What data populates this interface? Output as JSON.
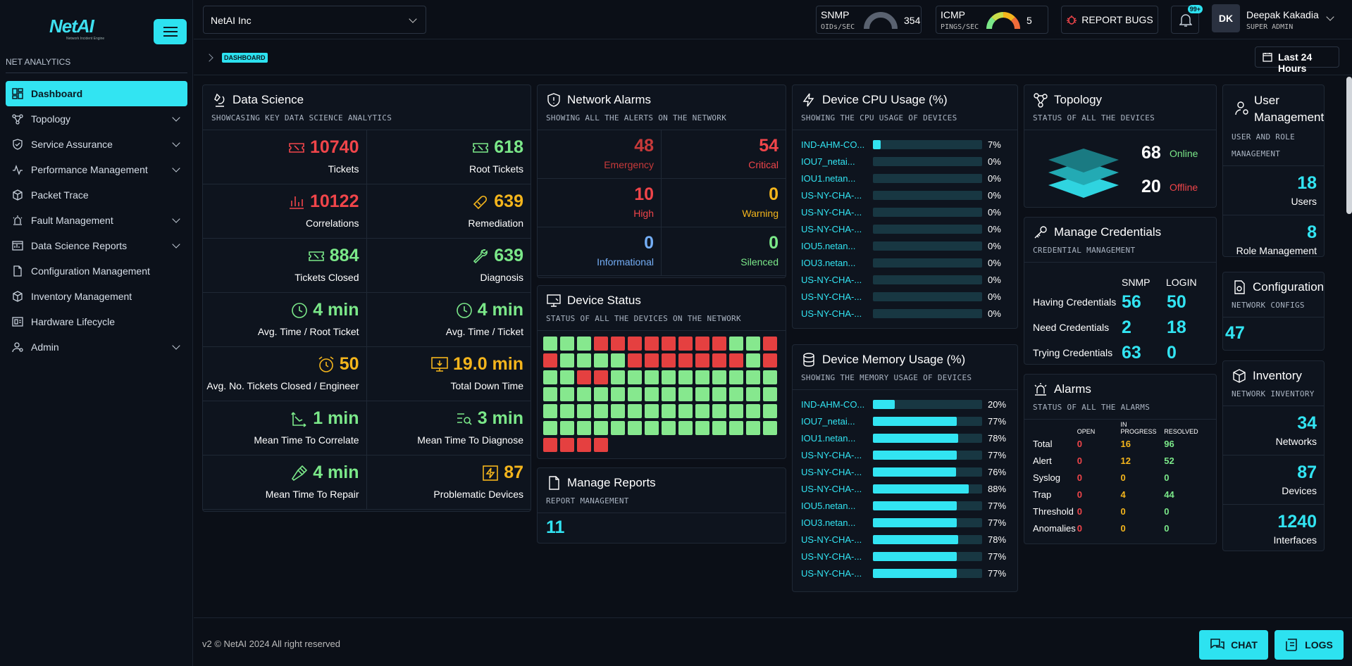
{
  "app": {
    "brand": "NetAI",
    "tagline": "Network Incident Engine"
  },
  "sidebar": {
    "section_title": "NET ANALYTICS",
    "items": [
      {
        "label": "Dashboard",
        "icon": "dashboard-icon",
        "active": true
      },
      {
        "label": "Topology",
        "icon": "topology-icon"
      },
      {
        "label": "Service Assurance",
        "icon": "shield-icon"
      },
      {
        "label": "Performance Management",
        "icon": "pulse-icon"
      },
      {
        "label": "Packet Trace",
        "icon": "package-icon"
      },
      {
        "label": "Fault Management",
        "icon": "siren-icon"
      },
      {
        "label": "Data Science Reports",
        "icon": "report-icon"
      },
      {
        "label": "Configuration Management",
        "icon": "file-icon"
      },
      {
        "label": "Inventory Management",
        "icon": "box-icon"
      },
      {
        "label": "Hardware Lifecycle",
        "icon": "hardware-icon"
      },
      {
        "label": "Admin",
        "icon": "admin-icon"
      }
    ]
  },
  "header": {
    "org": "NetAI Inc",
    "snmp": {
      "label": "SNMP",
      "sub": "OIDs/SEC",
      "value": "354"
    },
    "icmp": {
      "label": "ICMP",
      "sub": "PINGS/SEC",
      "value": "5"
    },
    "report_bugs": "REPORT BUGS",
    "notif_badge": "99+",
    "user": {
      "initials": "DK",
      "name": "Deepak Kakadia",
      "role": "SUPER ADMIN"
    }
  },
  "breadcrumb": {
    "current": "DASHBOARD",
    "range": "Last 24 Hours"
  },
  "data_science": {
    "title": "Data Science",
    "subtitle": "SHOWCASING KEY DATA SCIENCE ANALYTICS",
    "cells": [
      {
        "value": "10740",
        "label": "Tickets",
        "color": "red",
        "icon": "ticket-icon"
      },
      {
        "value": "618",
        "label": "Root Tickets",
        "color": "green",
        "icon": "ticket-icon"
      },
      {
        "value": "10122",
        "label": "Correlations",
        "color": "red",
        "icon": "bar-chart-icon"
      },
      {
        "value": "639",
        "label": "Remediation",
        "color": "amber",
        "icon": "bandage-icon"
      },
      {
        "value": "884",
        "label": "Tickets Closed",
        "color": "green",
        "icon": "ticket-icon"
      },
      {
        "value": "639",
        "label": "Diagnosis",
        "color": "green",
        "icon": "wrench-icon"
      },
      {
        "value": "4 min",
        "label": "Avg. Time / Root Ticket",
        "color": "green",
        "icon": "clock-icon"
      },
      {
        "value": "4 min",
        "label": "Avg. Time / Ticket",
        "color": "green",
        "icon": "clock-icon"
      },
      {
        "value": "50",
        "label": "Avg. No. Tickets Closed / Engineer",
        "color": "amber",
        "icon": "alarm-clock-icon"
      },
      {
        "value": "19.0 min",
        "label": "Total Down Time",
        "color": "amber",
        "icon": "monitor-down-icon"
      },
      {
        "value": "1 min",
        "label": "Mean Time To Correlate",
        "color": "green",
        "icon": "axis-arrow-icon"
      },
      {
        "value": "3 min",
        "label": "Mean Time To Diagnose",
        "color": "green",
        "icon": "list-search-icon"
      },
      {
        "value": "4 min",
        "label": "Mean Time To Repair",
        "color": "green",
        "icon": "hammer-icon"
      },
      {
        "value": "87",
        "label": "Problematic Devices",
        "color": "amber",
        "icon": "bolt-box-icon"
      }
    ]
  },
  "alarms_card": {
    "title": "Network Alarms",
    "subtitle": "SHOWING ALL THE ALERTS ON THE NETWORK",
    "cells": [
      {
        "value": "48",
        "label": "Emergency",
        "color": "dkred"
      },
      {
        "value": "54",
        "label": "Critical",
        "color": "red"
      },
      {
        "value": "10",
        "label": "High",
        "color": "red"
      },
      {
        "value": "0",
        "label": "Warning",
        "color": "amber"
      },
      {
        "value": "0",
        "label": "Informational",
        "color": "blue"
      },
      {
        "value": "0",
        "label": "Silenced",
        "color": "green"
      }
    ]
  },
  "device_status": {
    "title": "Device Status",
    "subtitle": "STATUS OF ALL THE DEVICES ON THE NETWORK",
    "cells": [
      "up",
      "up",
      "up",
      "down",
      "down",
      "down",
      "down",
      "down",
      "down",
      "down",
      "down",
      "up",
      "up",
      "down",
      "down",
      "up",
      "up",
      "up",
      "up",
      "down",
      "down",
      "down",
      "down",
      "down",
      "down",
      "down",
      "up",
      "down",
      "up",
      "up",
      "down",
      "down",
      "up",
      "up",
      "up",
      "up",
      "up",
      "up",
      "up",
      "up",
      "up",
      "up",
      "up",
      "up",
      "up",
      "up",
      "up",
      "up",
      "up",
      "up",
      "up",
      "up",
      "up",
      "up",
      "up",
      "up",
      "up",
      "up",
      "up",
      "up",
      "up",
      "up",
      "up",
      "up",
      "up",
      "up",
      "up",
      "up",
      "up",
      "up",
      "up",
      "up",
      "up",
      "up",
      "up",
      "up",
      "up",
      "up",
      "up",
      "up",
      "up",
      "up",
      "up",
      "up",
      "down",
      "down",
      "down",
      "down"
    ]
  },
  "manage_reports": {
    "title": "Manage Reports",
    "subtitle": "REPORT MANAGEMENT",
    "value": "11"
  },
  "cpu": {
    "title": "Device CPU Usage (%)",
    "subtitle": "SHOWING THE CPU USAGE OF DEVICES",
    "rows": [
      {
        "name": "IND-AHM-CO...",
        "pct": 7,
        "label": "7%"
      },
      {
        "name": "IOU7_netai...",
        "pct": 0,
        "label": "0%"
      },
      {
        "name": "IOU1.netan...",
        "pct": 0,
        "label": "0%"
      },
      {
        "name": "US-NY-CHA-...",
        "pct": 0,
        "label": "0%"
      },
      {
        "name": "US-NY-CHA-...",
        "pct": 0,
        "label": "0%"
      },
      {
        "name": "US-NY-CHA-...",
        "pct": 0,
        "label": "0%"
      },
      {
        "name": "IOU5.netan...",
        "pct": 0,
        "label": "0%"
      },
      {
        "name": "IOU3.netan...",
        "pct": 0,
        "label": "0%"
      },
      {
        "name": "US-NY-CHA-...",
        "pct": 0,
        "label": "0%"
      },
      {
        "name": "US-NY-CHA-...",
        "pct": 0,
        "label": "0%"
      },
      {
        "name": "US-NY-CHA-...",
        "pct": 0,
        "label": "0%"
      }
    ]
  },
  "memory": {
    "title": "Device Memory Usage (%)",
    "subtitle": "SHOWING THE MEMORY USAGE OF DEVICES",
    "rows": [
      {
        "name": "IND-AHM-CO...",
        "pct": 20,
        "label": "20%"
      },
      {
        "name": "IOU7_netai...",
        "pct": 77,
        "label": "77%"
      },
      {
        "name": "IOU1.netan...",
        "pct": 78,
        "label": "78%"
      },
      {
        "name": "US-NY-CHA-...",
        "pct": 77,
        "label": "77%"
      },
      {
        "name": "US-NY-CHA-...",
        "pct": 76,
        "label": "76%"
      },
      {
        "name": "US-NY-CHA-...",
        "pct": 88,
        "label": "88%"
      },
      {
        "name": "IOU5.netan...",
        "pct": 77,
        "label": "77%"
      },
      {
        "name": "IOU3.netan...",
        "pct": 77,
        "label": "77%"
      },
      {
        "name": "US-NY-CHA-...",
        "pct": 78,
        "label": "78%"
      },
      {
        "name": "US-NY-CHA-...",
        "pct": 77,
        "label": "77%"
      },
      {
        "name": "US-NY-CHA-...",
        "pct": 77,
        "label": "77%"
      }
    ]
  },
  "topology": {
    "title": "Topology",
    "subtitle": "STATUS OF ALL THE DEVICES",
    "online_value": "68",
    "online_label": "Online",
    "offline_value": "20",
    "offline_label": "Offline"
  },
  "credentials": {
    "title": "Manage Credentials",
    "subtitle": "CREDENTIAL MANAGEMENT",
    "col1": "SNMP",
    "col2": "LOGIN",
    "rows": [
      {
        "label": "Having Credentials",
        "snmp": "56",
        "login": "50"
      },
      {
        "label": "Need Credentials",
        "snmp": "2",
        "login": "18"
      },
      {
        "label": "Trying Credentials",
        "snmp": "63",
        "login": "0"
      }
    ]
  },
  "alarms_table": {
    "title": "Alarms",
    "subtitle": "STATUS OF ALL THE ALARMS",
    "headers": [
      "OPEN",
      "IN PROGRESS",
      "RESOLVED"
    ],
    "rows": [
      {
        "name": "Total",
        "open": "0",
        "prog": "16",
        "res": "96"
      },
      {
        "name": "Alert",
        "open": "0",
        "prog": "12",
        "res": "52"
      },
      {
        "name": "Syslog",
        "open": "0",
        "prog": "0",
        "res": "0"
      },
      {
        "name": "Trap",
        "open": "0",
        "prog": "4",
        "res": "44"
      },
      {
        "name": "Threshold",
        "open": "0",
        "prog": "0",
        "res": "0"
      },
      {
        "name": "Anomalies",
        "open": "0",
        "prog": "0",
        "res": "0"
      }
    ]
  },
  "user_mgmt": {
    "title": "User Management",
    "subtitle": "USER AND ROLE MANAGEMENT",
    "users_value": "18",
    "users_label": "Users",
    "roles_value": "8",
    "roles_label": "Role Management"
  },
  "configurations": {
    "title": "Configurations",
    "subtitle": "NETWORK CONFIGS",
    "value": "47"
  },
  "inventory": {
    "title": "Inventory",
    "subtitle": "NETWORK INVENTORY",
    "networks_value": "34",
    "networks_label": "Networks",
    "devices_value": "87",
    "devices_label": "Devices",
    "interfaces_value": "1240",
    "interfaces_label": "Interfaces"
  },
  "footer": {
    "copyright": "v2 © NetAI 2024 All right reserved",
    "chat": "CHAT",
    "logs": "LOGS"
  }
}
